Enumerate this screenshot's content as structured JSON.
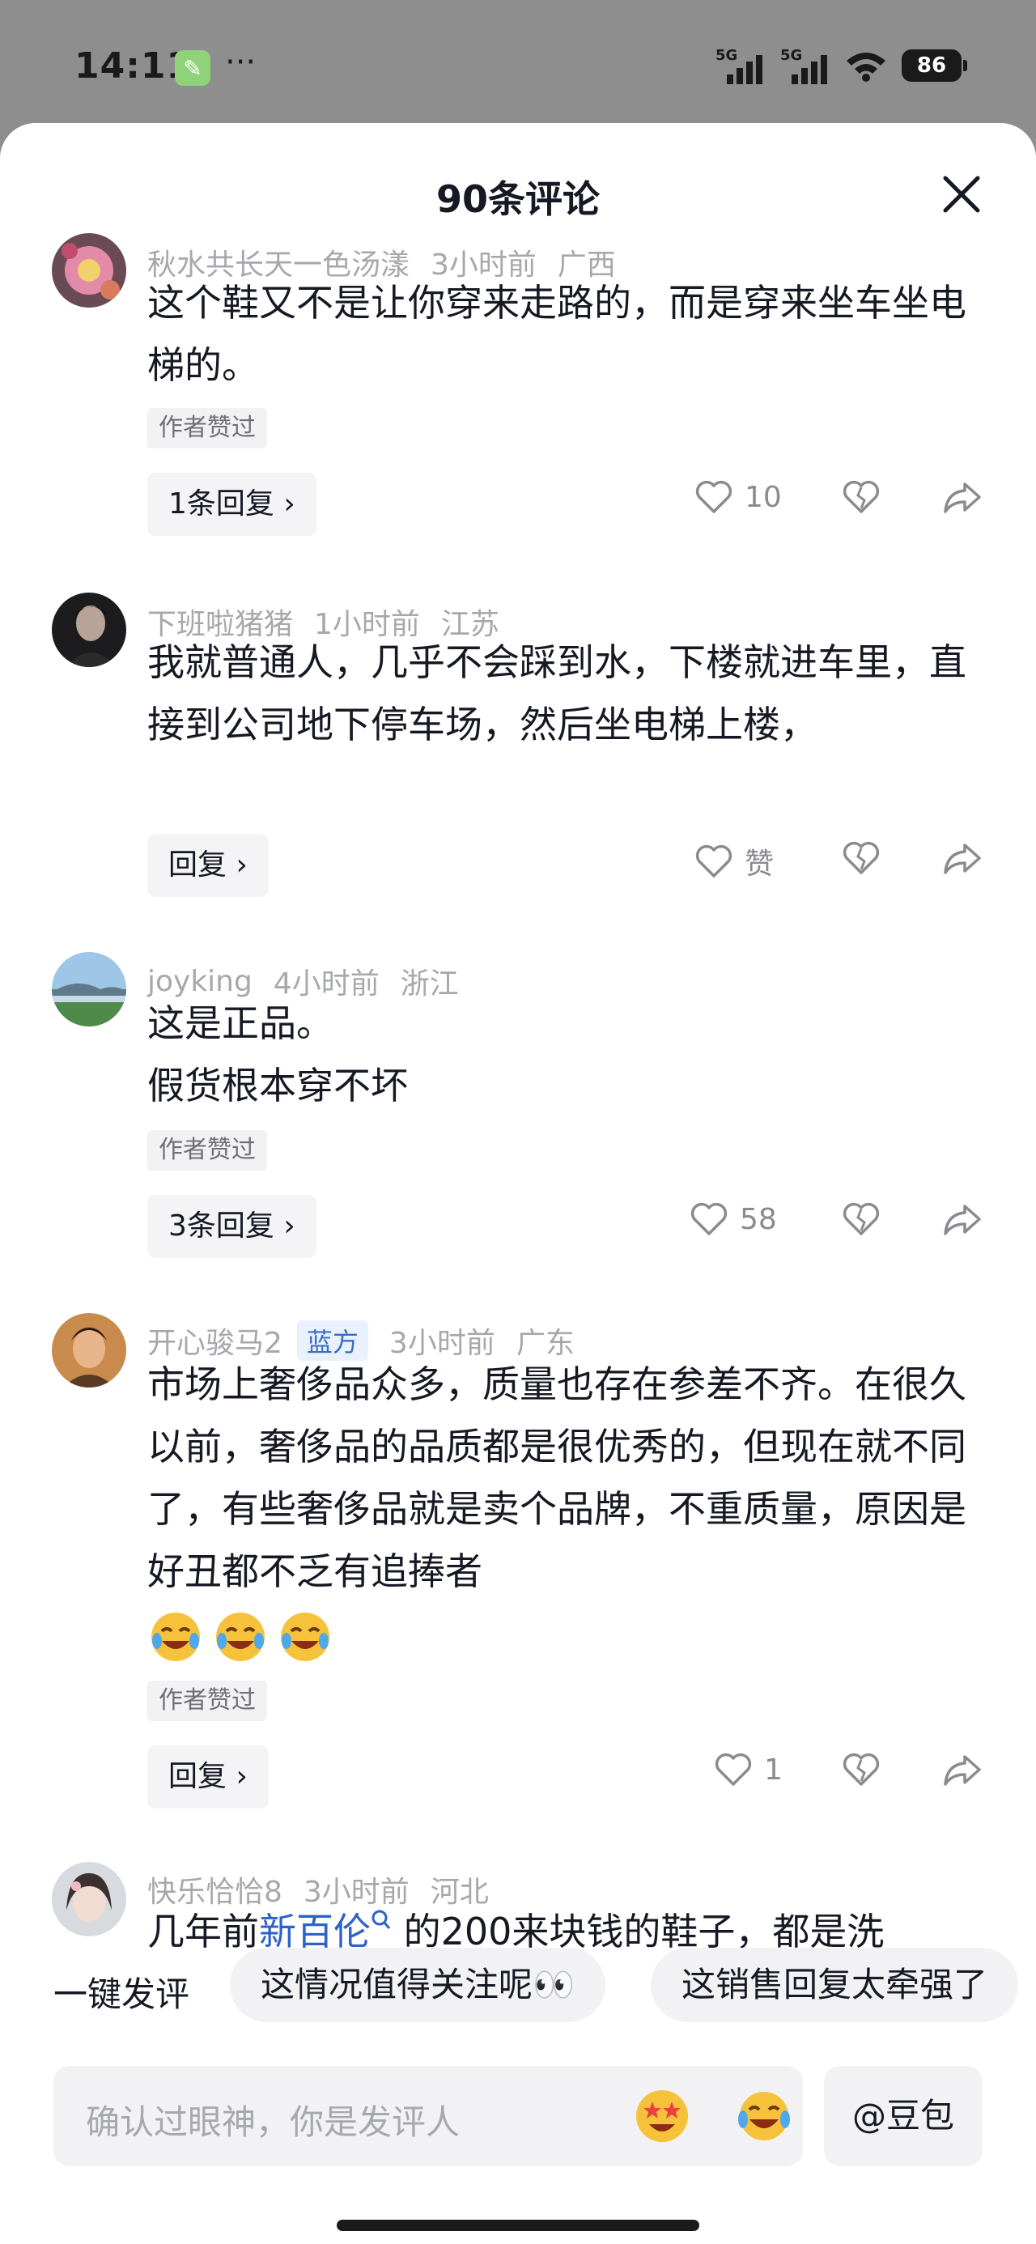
{
  "status_bar": {
    "time": "14:11",
    "network1": "5G",
    "network2": "5G",
    "battery": "86"
  },
  "header": {
    "title": "90条评论"
  },
  "comments": [
    {
      "username": "秋水共长天一色汤漾",
      "time": "3小时前",
      "location": "广西",
      "text": "这个鞋又不是让你穿来走路的，而是穿来坐车坐电梯的。",
      "author_liked": "作者赞过",
      "reply_label": "1条回复",
      "likes": "10"
    },
    {
      "username": "下班啦猪猪",
      "time": "1小时前",
      "location": "江苏",
      "text": "我就普通人，几乎不会踩到水，下楼就进车里，直接到公司地下停车场，然后坐电梯上楼，",
      "reply_label": "回复",
      "likes": "赞"
    },
    {
      "username": "joyking",
      "time": "4小时前",
      "location": "浙江",
      "text_line1": "这是正品。",
      "text_line2": "假货根本穿不坏",
      "author_liked": "作者赞过",
      "reply_label": "3条回复",
      "likes": "58"
    },
    {
      "username": "开心骏马2",
      "badge": "蓝方",
      "time": "3小时前",
      "location": "广东",
      "text": "市场上奢侈品众多，质量也存在参差不齐。在很久以前，奢侈品的品质都是很优秀的，但现在就不同了，有些奢侈品就是卖个品牌，不重质量，原因是好丑都不乏有追捧者",
      "emojis": [
        "crying-laughing",
        "crying-laughing",
        "crying-laughing"
      ],
      "author_liked": "作者赞过",
      "reply_label": "回复",
      "likes": "1"
    },
    {
      "username": "快乐恰恰8",
      "time": "3小时前",
      "location": "河北",
      "text_prefix": "几年前",
      "text_link": "新百伦",
      "text_suffix": "的200来块钱的鞋子，都是洗"
    }
  ],
  "quick_comments": {
    "label": "一键发评",
    "chips": [
      "这情况值得关注呢👀",
      "这销售回复太牵强了"
    ]
  },
  "input": {
    "placeholder": "确认过眼神，你是发评人",
    "doubao_label": "@豆包"
  },
  "colors": {
    "link": "#2d62c8",
    "muted": "#a7a8ad",
    "badge_bg": "#e8f1fd"
  }
}
